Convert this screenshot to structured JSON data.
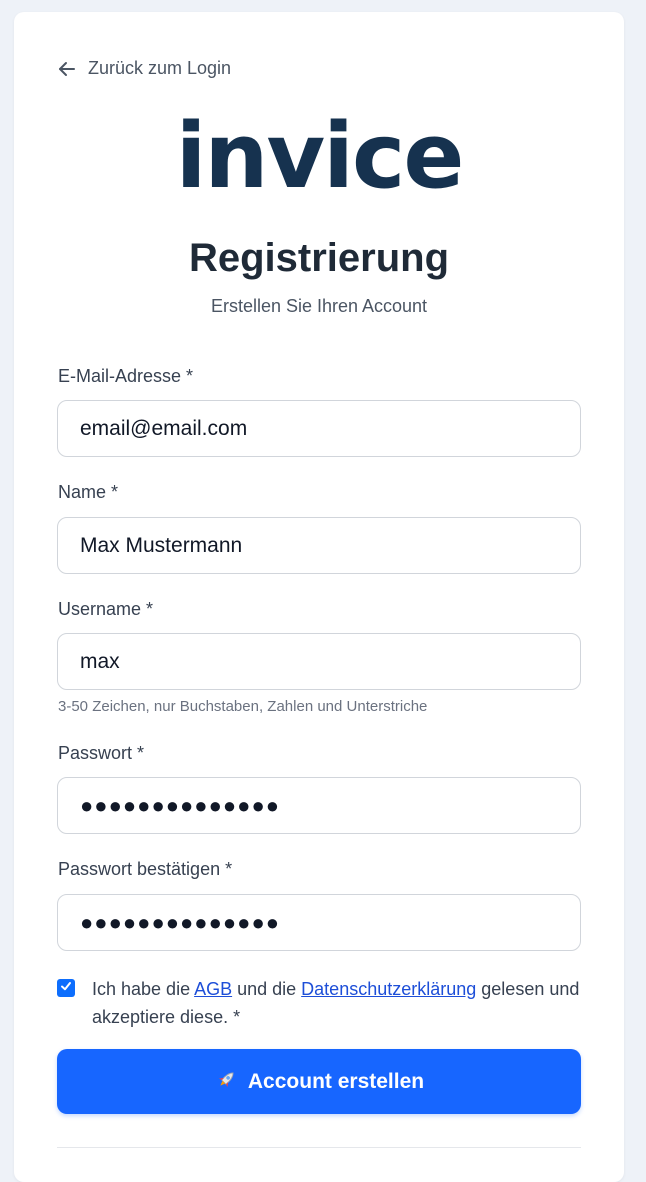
{
  "nav": {
    "back_label": "Zurück zum Login"
  },
  "brand": {
    "logo_text": "invice",
    "color": "#16324f"
  },
  "header": {
    "title": "Registrierung",
    "subtitle": "Erstellen Sie Ihren Account"
  },
  "form": {
    "email": {
      "label": "E-Mail-Adresse *",
      "value": "email@email.com"
    },
    "name": {
      "label": "Name *",
      "value": "Max Mustermann"
    },
    "username": {
      "label": "Username *",
      "value": "max",
      "hint": "3-50 Zeichen, nur Buchstaben, Zahlen und Unterstriche"
    },
    "password": {
      "label": "Passwort *",
      "value": "●●●●●●●●●●●●●●"
    },
    "password_confirm": {
      "label": "Passwort bestätigen *",
      "value": "●●●●●●●●●●●●●●"
    }
  },
  "terms": {
    "checked": true,
    "text_1": "Ich habe die ",
    "agb_link": "AGB",
    "text_2": " und die ",
    "privacy_link": "Datenschutzerklärung",
    "text_3": " gelesen und akzeptiere diese. *"
  },
  "submit": {
    "icon": "rocket-icon",
    "label": "Account erstellen",
    "color": "#1766ff"
  }
}
